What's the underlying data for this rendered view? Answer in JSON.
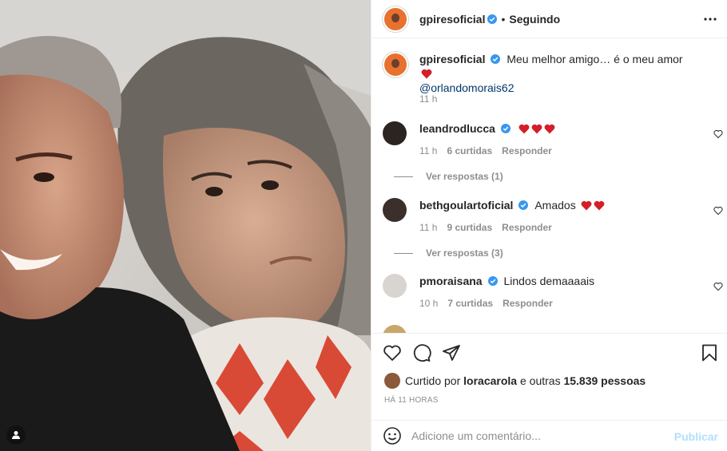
{
  "post": {
    "author": "gpiresoficial",
    "follow_state": "Seguindo",
    "caption_text": "Meu melhor amigo… é o meu amor",
    "caption_mention": "@orlandomorais62",
    "caption_time": "11 h"
  },
  "comments": [
    {
      "user": "leandrodlucca",
      "text": "",
      "hearts": 3,
      "time": "11 h",
      "likes": "6 curtidas",
      "reply": "Responder",
      "replies": "Ver respostas (1)"
    },
    {
      "user": "bethgoulartoficial",
      "text": "Amados",
      "hearts": 2,
      "time": "11 h",
      "likes": "9 curtidas",
      "reply": "Responder",
      "replies": "Ver respostas (3)"
    },
    {
      "user": "pmoraisana",
      "text": "Lindos demaaaais",
      "hearts": 0,
      "time": "10 h",
      "likes": "7 curtidas",
      "reply": "Responder"
    }
  ],
  "likes": {
    "prefix": "Curtido por",
    "user": "loracarola",
    "middle": "e outras",
    "count": "15.839 pessoas"
  },
  "timestamp": "HÁ 11 HORAS",
  "composer": {
    "placeholder": "Adicione um comentário...",
    "publish_label": "Publicar"
  },
  "colors": {
    "heart_red": "#ed4956",
    "link_blue": "#00376b",
    "publish_disabled": "#b2dffc",
    "verified_blue": "#3897f0"
  }
}
